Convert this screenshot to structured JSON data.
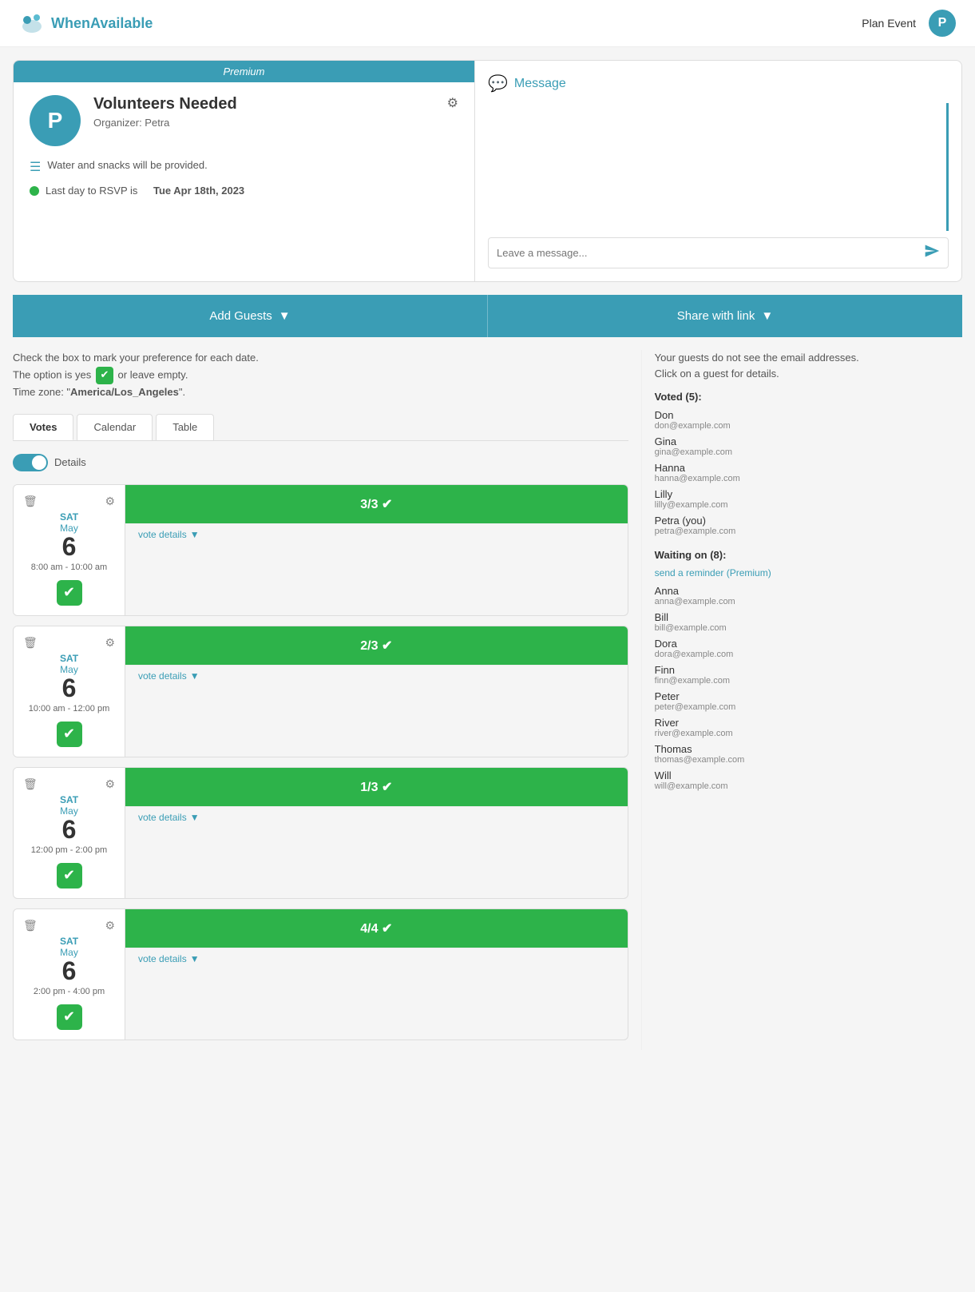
{
  "header": {
    "logo_text": "WhenAvailable",
    "plan_event_label": "Plan Event",
    "user_initial": "P"
  },
  "event": {
    "premium_label": "Premium",
    "title": "Volunteers Needed",
    "organizer": "Organizer: Petra",
    "organizer_initial": "P",
    "description": "Water and snacks will be provided.",
    "rsvp_prefix": "Last day to RSVP is",
    "rsvp_date": "Tue Apr 18th, 2023",
    "settings_icon": "⚙"
  },
  "message": {
    "title": "Message",
    "placeholder": "Leave a message..."
  },
  "actions": {
    "add_guests": "Add Guests",
    "share_link": "Share with link"
  },
  "instructions": {
    "line1": "Check the box to mark your preference for each date.",
    "line2_prefix": "The option is  yes",
    "line2_suffix": " or leave empty.",
    "line3_prefix": "Time zone: \"",
    "timezone": "America/Los_Angeles",
    "line3_suffix": "\"."
  },
  "tabs": [
    {
      "label": "Votes",
      "active": true
    },
    {
      "label": "Calendar",
      "active": false
    },
    {
      "label": "Table",
      "active": false
    }
  ],
  "toggle": {
    "label": "Details"
  },
  "date_slots": [
    {
      "day_name": "SAT",
      "month": "May",
      "day_num": "6",
      "time": "8:00 am - 10:00 am",
      "vote_count": "3/3",
      "vote_details": "vote details",
      "bar_class": "full",
      "checked": true
    },
    {
      "day_name": "SAT",
      "month": "May",
      "day_num": "6",
      "time": "10:00 am - 12:00 pm",
      "vote_count": "2/3",
      "vote_details": "vote details",
      "bar_class": "partial",
      "checked": true
    },
    {
      "day_name": "SAT",
      "month": "May",
      "day_num": "6",
      "time": "12:00 pm - 2:00 pm",
      "vote_count": "1/3",
      "vote_details": "vote details",
      "bar_class": "partial",
      "checked": true
    },
    {
      "day_name": "SAT",
      "month": "May",
      "day_num": "6",
      "time": "2:00 pm - 4:00 pm",
      "vote_count": "4/4",
      "vote_details": "vote details",
      "bar_class": "full",
      "checked": true
    }
  ],
  "right_panel": {
    "privacy_note": "Your guests do not see the email addresses.",
    "click_note": "Click on a guest for details.",
    "voted_label": "Voted (5):",
    "voted_guests": [
      {
        "name": "Don",
        "email": "don@example.com"
      },
      {
        "name": "Gina",
        "email": "gina@example.com"
      },
      {
        "name": "Hanna",
        "email": "hanna@example.com"
      },
      {
        "name": "Lilly",
        "email": "lilly@example.com"
      },
      {
        "name": "Petra (you)",
        "email": "petra@example.com"
      }
    ],
    "waiting_label": "Waiting on (8):",
    "reminder_label": "send a reminder (Premium)",
    "waiting_guests": [
      {
        "name": "Anna",
        "email": "anna@example.com"
      },
      {
        "name": "Bill",
        "email": "bill@example.com"
      },
      {
        "name": "Dora",
        "email": "dora@example.com"
      },
      {
        "name": "Finn",
        "email": "finn@example.com"
      },
      {
        "name": "Peter",
        "email": "peter@example.com"
      },
      {
        "name": "River",
        "email": "river@example.com"
      },
      {
        "name": "Thomas",
        "email": "thomas@example.com"
      },
      {
        "name": "Will",
        "email": "will@example.com"
      }
    ]
  }
}
